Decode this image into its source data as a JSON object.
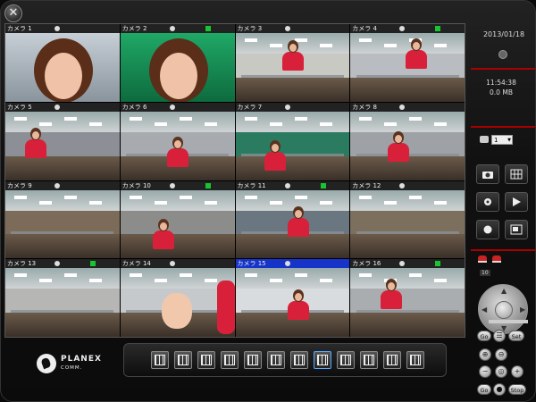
{
  "window": {
    "close_glyph": "✕"
  },
  "cameras": [
    {
      "label": "カメラ 1",
      "rec": false,
      "selected": false
    },
    {
      "label": "カメラ 2",
      "rec": true,
      "selected": false
    },
    {
      "label": "カメラ 3",
      "rec": false,
      "selected": false
    },
    {
      "label": "カメラ 4",
      "rec": true,
      "selected": false
    },
    {
      "label": "カメラ 5",
      "rec": false,
      "selected": false
    },
    {
      "label": "カメラ 6",
      "rec": false,
      "selected": false
    },
    {
      "label": "カメラ 7",
      "rec": false,
      "selected": false
    },
    {
      "label": "カメラ 8",
      "rec": false,
      "selected": false
    },
    {
      "label": "カメラ 9",
      "rec": false,
      "selected": false
    },
    {
      "label": "カメラ 10",
      "rec": true,
      "selected": false
    },
    {
      "label": "カメラ 11",
      "rec": true,
      "selected": false
    },
    {
      "label": "カメラ 12",
      "rec": false,
      "selected": false
    },
    {
      "label": "カメラ 13",
      "rec": true,
      "selected": false
    },
    {
      "label": "カメラ 14",
      "rec": false,
      "selected": false
    },
    {
      "label": "カメラ 15",
      "rec": false,
      "selected": true
    },
    {
      "label": "カメラ 16",
      "rec": true,
      "selected": false
    }
  ],
  "status": {
    "date": "2013/01/18",
    "time": "11:54:38",
    "size": "0.0 MB"
  },
  "camera_select": {
    "value": "1"
  },
  "ptz": {
    "label": "10",
    "go_label": "Go",
    "set_label": "Set",
    "go2_label": "Go",
    "stop_label": "Stop",
    "minus_glyph": "−",
    "plus_glyph": "+"
  },
  "brand": {
    "name": "PLANEX",
    "sub": "COMM."
  },
  "layout_buttons": 12,
  "colors": {
    "rec": "#19c431",
    "selected_bar": "#1634c8",
    "alarm": "#c22222"
  }
}
